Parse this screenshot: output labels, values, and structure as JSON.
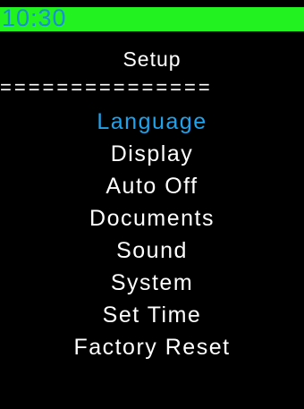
{
  "status_bar": {
    "time": "10:30",
    "background": "#22f21f",
    "time_color": "#1a8fd8"
  },
  "header": {
    "title": "Setup",
    "divider": "==============="
  },
  "menu": {
    "selected_index": 0,
    "selected_color": "#1ea3ec",
    "items": [
      {
        "label": "Language"
      },
      {
        "label": "Display"
      },
      {
        "label": "Auto Off"
      },
      {
        "label": "Documents"
      },
      {
        "label": "Sound"
      },
      {
        "label": "System"
      },
      {
        "label": "Set Time"
      },
      {
        "label": "Factory Reset"
      }
    ]
  }
}
